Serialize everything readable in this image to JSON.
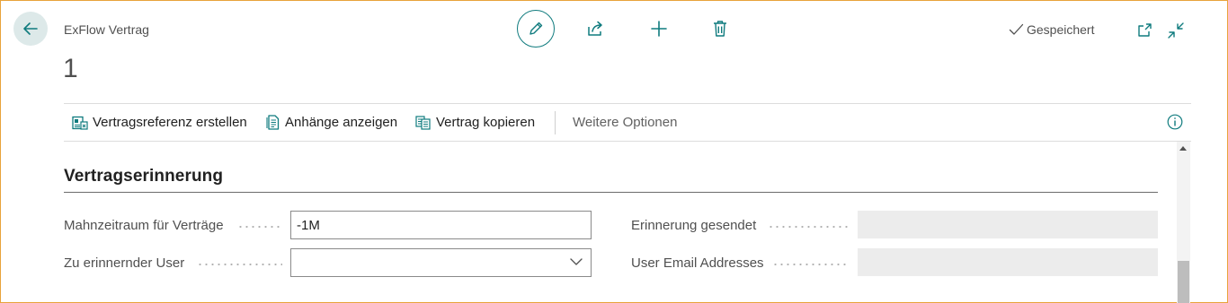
{
  "header": {
    "caption": "ExFlow Vertrag",
    "record_number": "1",
    "status": "Gespeichert"
  },
  "toolbar_icons": {
    "back": "arrow-left-icon",
    "edit": "pencil-icon",
    "share": "share-icon",
    "new": "plus-icon",
    "delete": "trash-icon",
    "open_new_window": "open-in-new-window-icon",
    "collapse": "collapse-icon",
    "info": "info-icon"
  },
  "actionbar": {
    "items": [
      {
        "label": "Vertragsreferenz erstellen",
        "icon": "contract-reference-icon"
      },
      {
        "label": "Anhänge anzeigen",
        "icon": "attachment-document-icon"
      },
      {
        "label": "Vertrag kopieren",
        "icon": "copy-document-icon"
      }
    ],
    "more_label": "Weitere Optionen"
  },
  "section": {
    "title": "Vertragserinnerung",
    "fields_left": [
      {
        "label": "Mahnzeitraum für Verträge",
        "value": "-1M",
        "type": "text"
      },
      {
        "label": "Zu erinnernder User",
        "value": "",
        "type": "select"
      }
    ],
    "fields_right": [
      {
        "label": "Erinnerung gesendet",
        "value": ""
      },
      {
        "label": "User Email Addresses",
        "value": ""
      }
    ]
  },
  "colors": {
    "accent": "#0f7b7e",
    "frame_border": "#e8a33b",
    "back_button_bg": "#dde9e9",
    "readonly_bg": "#ececec"
  }
}
